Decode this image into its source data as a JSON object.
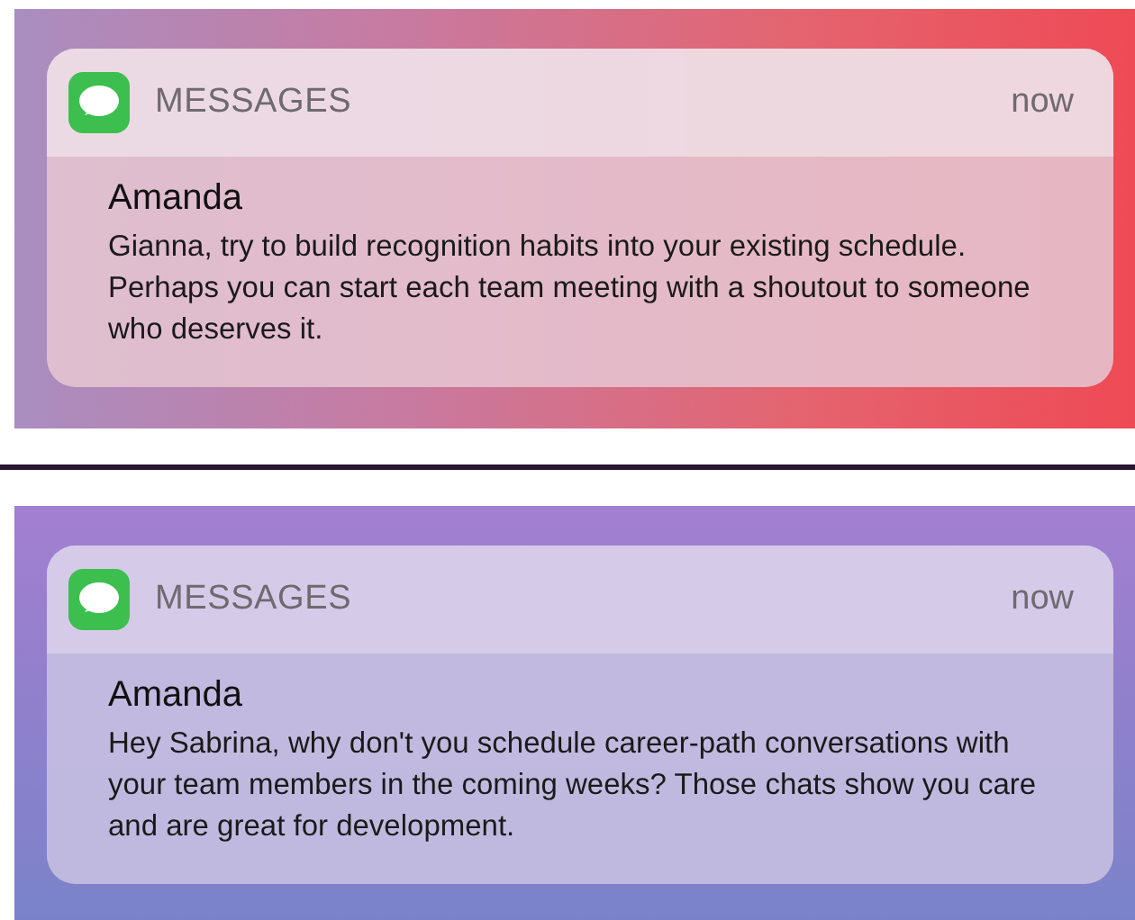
{
  "notifications": [
    {
      "app": "MESSAGES",
      "time": "now",
      "sender": "Amanda",
      "message": "Gianna, try to build recognition habits into your existing schedule. Perhaps you can start each team meeting with a shoutout to someone who deserves it."
    },
    {
      "app": "MESSAGES",
      "time": "now",
      "sender": "Amanda",
      "message": "Hey Sabrina, why don't you schedule career-path conversations with your team members in the coming weeks? Those chats show you care and are great for development."
    }
  ]
}
